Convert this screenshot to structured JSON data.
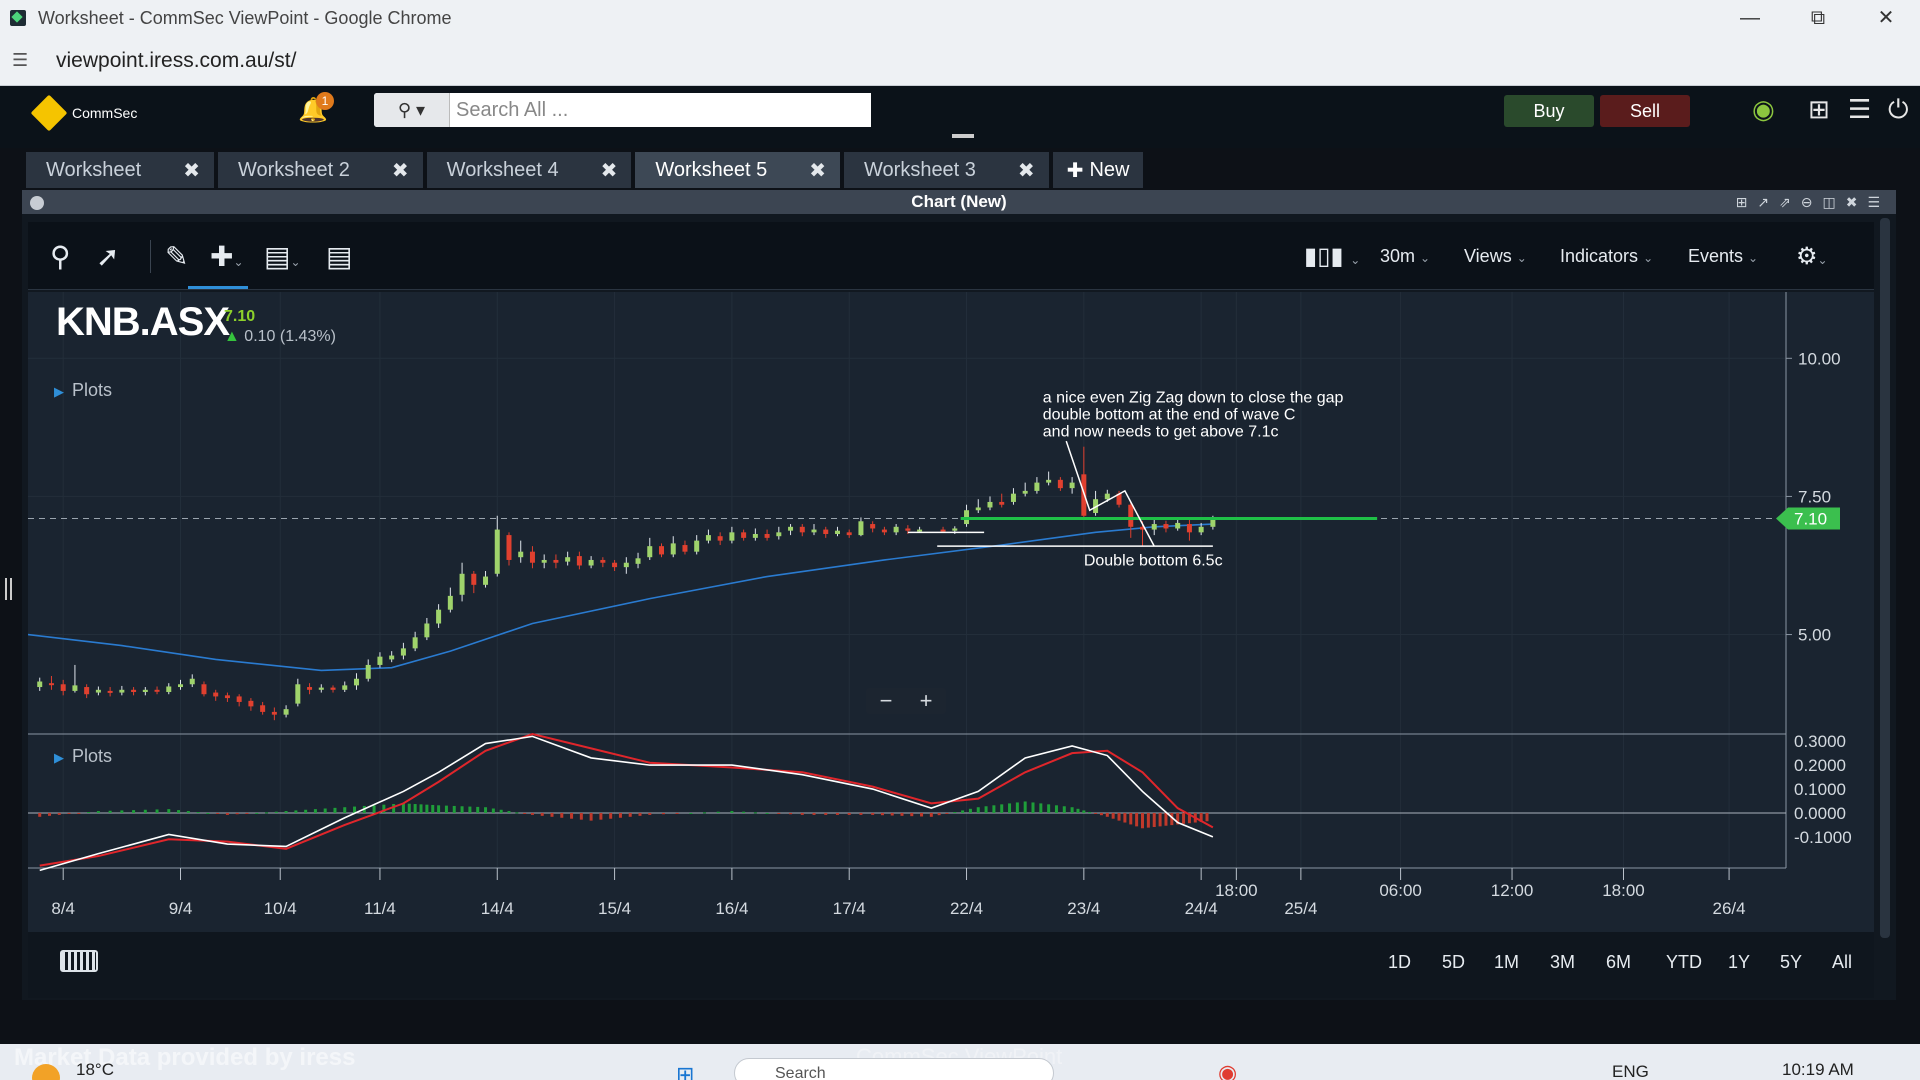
{
  "window": {
    "title": "Worksheet - CommSec ViewPoint - Google Chrome",
    "url": "viewpoint.iress.com.au/st/"
  },
  "header": {
    "brand": "CommSec",
    "notifications": "1",
    "search_placeholder": "Search All ...",
    "buy_label": "Buy",
    "sell_label": "Sell"
  },
  "tabs": [
    {
      "label": "Worksheet",
      "active": false
    },
    {
      "label": "Worksheet 2",
      "active": false
    },
    {
      "label": "Worksheet 4",
      "active": false
    },
    {
      "label": "Worksheet 5",
      "active": true
    },
    {
      "label": "Worksheet 3",
      "active": false
    }
  ],
  "new_tab_label": "New",
  "panel": {
    "title": "Chart (New)"
  },
  "toolbar": {
    "interval": "30m",
    "views": "Views",
    "indicators": "Indicators",
    "events": "Events"
  },
  "quote": {
    "symbol": "KNB.ASX",
    "last": "7.10",
    "change": "0.10 (1.43%)"
  },
  "plots_label": "Plots",
  "chart_data": {
    "type": "candlestick",
    "symbol": "KNB.ASX",
    "interval": "30m",
    "price_axis": [
      "10.00",
      "7.50",
      "5.00"
    ],
    "last_price_tag": "7.10",
    "price_range": [
      3.2,
      11.2
    ],
    "osc_axis": [
      "0.3000",
      "0.2000",
      "0.1000",
      "0.0000",
      "-0.1000"
    ],
    "osc_range": [
      -0.23,
      0.33
    ],
    "x_ticks": [
      {
        "label": "8/4",
        "t": 0
      },
      {
        "label": "9/4",
        "t": 1
      },
      {
        "label": "10/4",
        "t": 1.85
      },
      {
        "label": "11/4",
        "t": 2.7
      },
      {
        "label": "14/4",
        "t": 3.7
      },
      {
        "label": "15/4",
        "t": 4.7
      },
      {
        "label": "16/4",
        "t": 5.7
      },
      {
        "label": "17/4",
        "t": 6.7
      },
      {
        "label": "22/4",
        "t": 7.7
      },
      {
        "label": "23/4",
        "t": 8.7
      },
      {
        "label": "24/4",
        "t": 9.7
      },
      {
        "label": "18:00",
        "t": 10.0,
        "upper": true
      },
      {
        "label": "25/4",
        "t": 10.55
      },
      {
        "label": "06:00",
        "t": 11.4,
        "upper": true
      },
      {
        "label": "12:00",
        "t": 12.35,
        "upper": true
      },
      {
        "label": "18:00",
        "t": 13.3,
        "upper": true
      },
      {
        "label": "26/4",
        "t": 14.2
      }
    ],
    "t_range": [
      -0.3,
      14.6
    ],
    "candles": [
      [
        -0.2,
        4.05,
        4.15,
        4.22,
        3.98
      ],
      [
        -0.1,
        4.12,
        4.1,
        4.25,
        4.0
      ],
      [
        0.0,
        4.1,
        3.98,
        4.18,
        3.9
      ],
      [
        0.1,
        3.98,
        4.08,
        4.45,
        3.95
      ],
      [
        0.2,
        4.05,
        3.92,
        4.1,
        3.85
      ],
      [
        0.3,
        3.95,
        4.0,
        4.06,
        3.9
      ],
      [
        0.4,
        3.98,
        3.95,
        4.05,
        3.88
      ],
      [
        0.5,
        3.95,
        4.0,
        4.07,
        3.9
      ],
      [
        0.6,
        4.0,
        3.96,
        4.05,
        3.9
      ],
      [
        0.7,
        3.96,
        4.0,
        4.05,
        3.9
      ],
      [
        0.8,
        4.0,
        3.98,
        4.06,
        3.92
      ],
      [
        0.9,
        3.96,
        4.06,
        4.12,
        3.92
      ],
      [
        1.0,
        4.05,
        4.1,
        4.18,
        4.0
      ],
      [
        1.1,
        4.1,
        4.2,
        4.28,
        4.05
      ],
      [
        1.2,
        4.1,
        3.92,
        4.15,
        3.88
      ],
      [
        1.3,
        3.95,
        3.88,
        4.0,
        3.8
      ],
      [
        1.4,
        3.9,
        3.85,
        3.95,
        3.78
      ],
      [
        1.5,
        3.88,
        3.78,
        3.92,
        3.7
      ],
      [
        1.6,
        3.8,
        3.7,
        3.85,
        3.62
      ],
      [
        1.7,
        3.72,
        3.6,
        3.78,
        3.55
      ],
      [
        1.8,
        3.6,
        3.55,
        3.68,
        3.45
      ],
      [
        1.9,
        3.55,
        3.65,
        3.72,
        3.5
      ],
      [
        2.0,
        3.75,
        4.1,
        4.2,
        3.7
      ],
      [
        2.1,
        4.05,
        4.0,
        4.12,
        3.92
      ],
      [
        2.2,
        4.0,
        4.04,
        4.1,
        3.95
      ],
      [
        2.3,
        4.04,
        4.0,
        4.08,
        3.95
      ],
      [
        2.4,
        4.0,
        4.08,
        4.15,
        3.96
      ],
      [
        2.5,
        4.08,
        4.2,
        4.3,
        4.0
      ],
      [
        2.6,
        4.2,
        4.45,
        4.55,
        4.15
      ],
      [
        2.7,
        4.45,
        4.6,
        4.68,
        4.4
      ],
      [
        2.8,
        4.55,
        4.62,
        4.7,
        4.5
      ],
      [
        2.9,
        4.62,
        4.75,
        4.85,
        4.55
      ],
      [
        3.0,
        4.75,
        4.95,
        5.05,
        4.7
      ],
      [
        3.1,
        4.95,
        5.2,
        5.3,
        4.9
      ],
      [
        3.2,
        5.2,
        5.45,
        5.55,
        5.12
      ],
      [
        3.3,
        5.45,
        5.7,
        5.85,
        5.4
      ],
      [
        3.4,
        5.72,
        6.1,
        6.3,
        5.6
      ],
      [
        3.5,
        6.1,
        5.9,
        6.15,
        5.75
      ],
      [
        3.6,
        5.9,
        6.05,
        6.15,
        5.85
      ],
      [
        3.7,
        6.1,
        6.9,
        7.15,
        6.05
      ],
      [
        3.8,
        6.8,
        6.35,
        6.85,
        6.25
      ],
      [
        3.9,
        6.4,
        6.5,
        6.7,
        6.3
      ],
      [
        4.0,
        6.5,
        6.3,
        6.6,
        6.2
      ],
      [
        4.1,
        6.3,
        6.35,
        6.45,
        6.2
      ],
      [
        4.2,
        6.35,
        6.3,
        6.45,
        6.2
      ],
      [
        4.3,
        6.32,
        6.4,
        6.5,
        6.25
      ],
      [
        4.4,
        6.42,
        6.25,
        6.5,
        6.18
      ],
      [
        4.5,
        6.25,
        6.35,
        6.42,
        6.2
      ],
      [
        4.6,
        6.35,
        6.3,
        6.4,
        6.22
      ],
      [
        4.7,
        6.3,
        6.22,
        6.35,
        6.15
      ],
      [
        4.8,
        6.22,
        6.3,
        6.4,
        6.1
      ],
      [
        4.9,
        6.28,
        6.38,
        6.48,
        6.2
      ],
      [
        5.0,
        6.4,
        6.6,
        6.75,
        6.35
      ],
      [
        5.1,
        6.6,
        6.45,
        6.65,
        6.4
      ],
      [
        5.2,
        6.45,
        6.65,
        6.78,
        6.4
      ],
      [
        5.3,
        6.62,
        6.5,
        6.7,
        6.45
      ],
      [
        5.4,
        6.5,
        6.7,
        6.8,
        6.45
      ],
      [
        5.5,
        6.7,
        6.8,
        6.9,
        6.65
      ],
      [
        5.6,
        6.78,
        6.7,
        6.85,
        6.62
      ],
      [
        5.7,
        6.7,
        6.85,
        6.95,
        6.65
      ],
      [
        5.8,
        6.85,
        6.75,
        6.9,
        6.7
      ],
      [
        5.9,
        6.75,
        6.82,
        6.92,
        6.7
      ],
      [
        6.0,
        6.82,
        6.75,
        6.9,
        6.7
      ],
      [
        6.1,
        6.78,
        6.85,
        6.95,
        6.72
      ],
      [
        6.2,
        6.88,
        6.95,
        7.0,
        6.8
      ],
      [
        6.3,
        6.95,
        6.85,
        7.0,
        6.78
      ],
      [
        6.4,
        6.85,
        6.9,
        7.0,
        6.8
      ],
      [
        6.5,
        6.9,
        6.82,
        6.95,
        6.75
      ],
      [
        6.6,
        6.82,
        6.88,
        6.95,
        6.78
      ],
      [
        6.7,
        6.85,
        6.8,
        6.9,
        6.75
      ],
      [
        6.8,
        6.8,
        7.05,
        7.12,
        6.78
      ],
      [
        6.9,
        7.0,
        6.92,
        7.05,
        6.85
      ],
      [
        7.0,
        6.9,
        6.85,
        6.95,
        6.8
      ],
      [
        7.1,
        6.85,
        6.95,
        7.0,
        6.8
      ],
      [
        7.2,
        6.92,
        6.88,
        6.98,
        6.82
      ],
      [
        7.3,
        6.88,
        6.9,
        6.95,
        6.85
      ],
      [
        7.5,
        6.9,
        6.88,
        6.95,
        6.85
      ],
      [
        7.6,
        6.88,
        6.92,
        6.96,
        6.82
      ],
      [
        7.7,
        7.0,
        7.25,
        7.35,
        6.95
      ],
      [
        7.8,
        7.25,
        7.3,
        7.45,
        7.2
      ],
      [
        7.9,
        7.3,
        7.4,
        7.5,
        7.25
      ],
      [
        8.0,
        7.4,
        7.35,
        7.55,
        7.3
      ],
      [
        8.1,
        7.4,
        7.55,
        7.65,
        7.35
      ],
      [
        8.2,
        7.55,
        7.6,
        7.75,
        7.5
      ],
      [
        8.3,
        7.6,
        7.75,
        7.85,
        7.55
      ],
      [
        8.4,
        7.75,
        7.8,
        7.95,
        7.7
      ],
      [
        8.5,
        7.8,
        7.65,
        7.85,
        7.6
      ],
      [
        8.6,
        7.65,
        7.75,
        7.85,
        7.55
      ],
      [
        8.7,
        7.9,
        7.15,
        8.4,
        7.1
      ],
      [
        8.8,
        7.2,
        7.45,
        7.6,
        7.15
      ],
      [
        8.9,
        7.45,
        7.55,
        7.62,
        7.4
      ],
      [
        9.0,
        7.55,
        7.35,
        7.6,
        7.3
      ],
      [
        9.1,
        7.35,
        6.95,
        7.4,
        6.75
      ],
      [
        9.2,
        6.95,
        6.9,
        7.05,
        6.6
      ],
      [
        9.3,
        6.9,
        7.0,
        7.08,
        6.8
      ],
      [
        9.4,
        7.0,
        6.92,
        7.06,
        6.85
      ],
      [
        9.5,
        6.92,
        7.02,
        7.08,
        6.88
      ],
      [
        9.6,
        7.0,
        6.85,
        7.08,
        6.7
      ],
      [
        9.7,
        6.85,
        6.95,
        7.02,
        6.8
      ],
      [
        9.8,
        6.95,
        7.1,
        7.15,
        6.9
      ]
    ],
    "moving_average": {
      "points": [
        [
          -0.3,
          5.0
        ],
        [
          0.5,
          4.8
        ],
        [
          1.3,
          4.55
        ],
        [
          2.2,
          4.35
        ],
        [
          2.8,
          4.4
        ],
        [
          3.3,
          4.7
        ],
        [
          4.0,
          5.2
        ],
        [
          5.0,
          5.65
        ],
        [
          6.0,
          6.05
        ],
        [
          7.0,
          6.35
        ],
        [
          8.0,
          6.62
        ],
        [
          8.8,
          6.85
        ],
        [
          9.3,
          6.95
        ],
        [
          9.8,
          7.0
        ]
      ]
    },
    "osc_signal": [
      [
        -0.2,
        -0.22
      ],
      [
        0.3,
        -0.18
      ],
      [
        0.9,
        -0.11
      ],
      [
        1.4,
        -0.12
      ],
      [
        1.9,
        -0.15
      ],
      [
        2.4,
        -0.05
      ],
      [
        2.9,
        0.04
      ],
      [
        3.2,
        0.13
      ],
      [
        3.6,
        0.26
      ],
      [
        4.0,
        0.33
      ],
      [
        4.5,
        0.27
      ],
      [
        5.0,
        0.21
      ],
      [
        5.7,
        0.19
      ],
      [
        6.3,
        0.17
      ],
      [
        6.9,
        0.11
      ],
      [
        7.4,
        0.04
      ],
      [
        7.8,
        0.06
      ],
      [
        8.2,
        0.17
      ],
      [
        8.6,
        0.25
      ],
      [
        8.9,
        0.26
      ],
      [
        9.2,
        0.17
      ],
      [
        9.5,
        0.02
      ],
      [
        9.8,
        -0.06
      ]
    ],
    "osc_macd": [
      [
        -0.2,
        -0.24
      ],
      [
        0.3,
        -0.17
      ],
      [
        0.9,
        -0.09
      ],
      [
        1.4,
        -0.13
      ],
      [
        1.9,
        -0.14
      ],
      [
        2.4,
        -0.02
      ],
      [
        2.9,
        0.09
      ],
      [
        3.2,
        0.17
      ],
      [
        3.6,
        0.29
      ],
      [
        4.0,
        0.32
      ],
      [
        4.5,
        0.23
      ],
      [
        5.0,
        0.2
      ],
      [
        5.7,
        0.2
      ],
      [
        6.3,
        0.16
      ],
      [
        6.9,
        0.1
      ],
      [
        7.4,
        0.02
      ],
      [
        7.8,
        0.09
      ],
      [
        8.2,
        0.23
      ],
      [
        8.6,
        0.28
      ],
      [
        8.9,
        0.24
      ],
      [
        9.2,
        0.09
      ],
      [
        9.5,
        -0.04
      ],
      [
        9.8,
        -0.1
      ]
    ],
    "annotations": {
      "note_lines": [
        "a nice even Zig Zag down to close the gap",
        "double bottom at the end of wave C",
        "and now needs to get above 7.1c"
      ],
      "double_bottom_label": "Double bottom 6.5c"
    }
  },
  "ranges": [
    "1D",
    "5D",
    "1M",
    "3M",
    "6M",
    "YTD",
    "1Y",
    "5Y",
    "All"
  ],
  "taskbar": {
    "overlay_text": "Market Data provided by",
    "overlay_brand": "iress",
    "overlay_center": "CommSec ViewPoint",
    "weather": "18°C",
    "search": "Search",
    "lang": "ENG",
    "time": "10:19 AM"
  }
}
